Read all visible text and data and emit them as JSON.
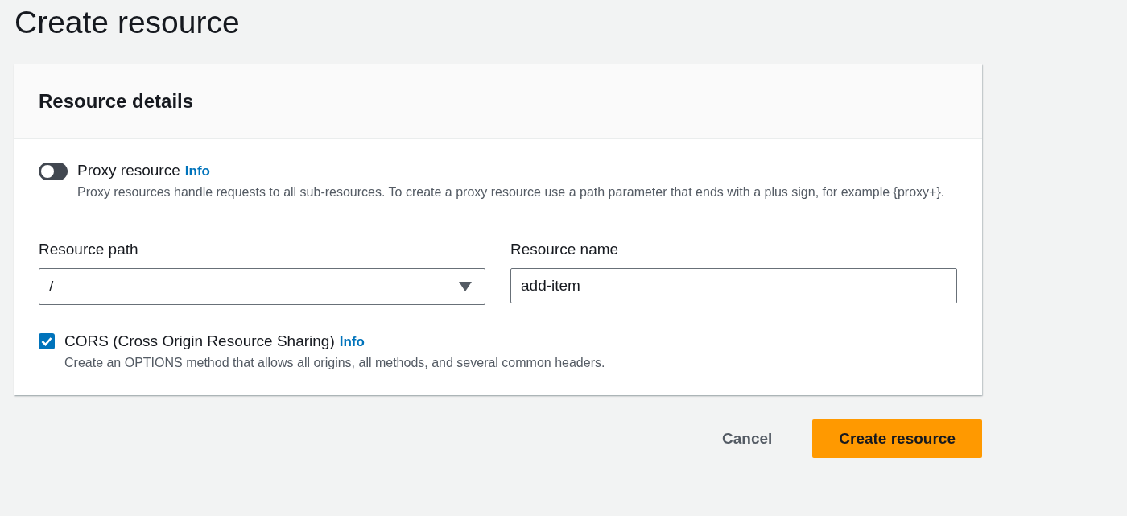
{
  "page": {
    "title": "Create resource"
  },
  "panel": {
    "title": "Resource details",
    "proxy": {
      "label": "Proxy resource",
      "info": "Info",
      "on": false,
      "description": "Proxy resources handle requests to all sub-resources. To create a proxy resource use a path parameter that ends with a plus sign, for example {proxy+}."
    },
    "fields": [
      {
        "kind": "select",
        "label": "Resource path",
        "value": "/"
      },
      {
        "kind": "input",
        "label": "Resource name",
        "value": "add-item"
      }
    ],
    "cors": {
      "label": "CORS (Cross Origin Resource Sharing)",
      "info": "Info",
      "checked": true,
      "description": "Create an OPTIONS method that allows all origins, all methods, and several common headers."
    }
  },
  "actions": [
    {
      "kind": "link",
      "label": "Cancel"
    },
    {
      "kind": "primary",
      "label": "Create resource"
    }
  ]
}
